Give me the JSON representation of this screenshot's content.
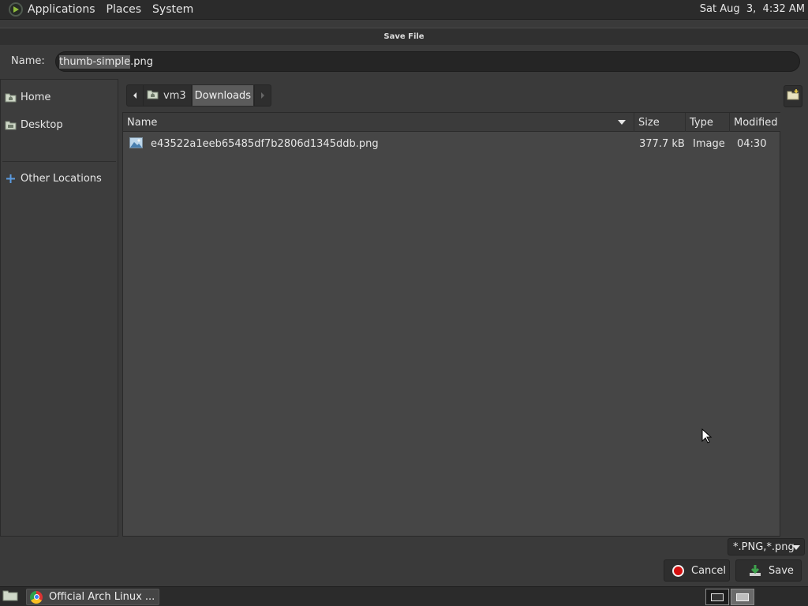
{
  "top_panel": {
    "menu": [
      "Applications",
      "Places",
      "System"
    ],
    "clock": "Sat Aug  3,  4:32 AM"
  },
  "dialog": {
    "title": "Save File",
    "name_label": "Name:",
    "filename_selected": "thumb-simple",
    "filename_ext": ".png"
  },
  "sidebar": {
    "items": [
      {
        "label": "Home",
        "icon": "home-folder-icon"
      },
      {
        "label": "Desktop",
        "icon": "desktop-folder-icon"
      },
      {
        "label": "Other Locations",
        "icon": "plus-icon"
      }
    ]
  },
  "pathbar": {
    "segments": [
      "vm3",
      "Downloads"
    ]
  },
  "filelist": {
    "columns": [
      "Name",
      "Size",
      "Type",
      "Modified"
    ],
    "rows": [
      {
        "name": "e43522a1eeb65485df7b2806d1345ddb.png",
        "size": "377.7 kB",
        "type": "Image",
        "modified": "04:30"
      }
    ]
  },
  "filter": {
    "selected": "*.PNG,*.png"
  },
  "buttons": {
    "cancel": "Cancel",
    "save": "Save"
  },
  "taskbar": {
    "task_label": "Official Arch Linux ..."
  },
  "colors": {
    "background": "#3a3a3a",
    "panel": "#2b2b2b",
    "cancel_red": "#d41010",
    "save_green": "#3fa34d"
  }
}
